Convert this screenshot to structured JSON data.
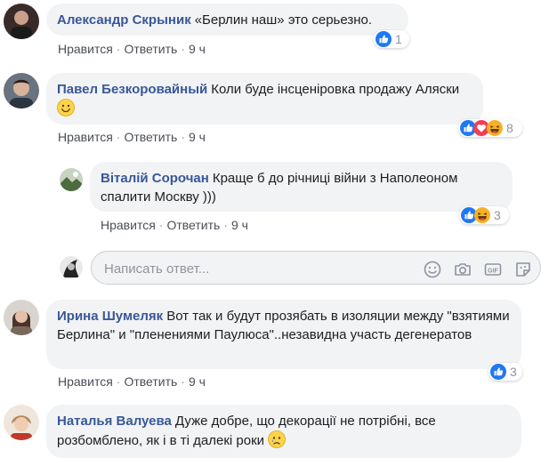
{
  "actions": {
    "like": "Нравится",
    "reply": "Ответить",
    "separator": "·"
  },
  "comments": [
    {
      "author": "Александр Скрыник",
      "text": "«Берлин наш» это серьезно.",
      "time": "9 ч",
      "reaction_count": "1",
      "reactions": [
        "like-icon"
      ]
    },
    {
      "author": "Павел Безкоровайный",
      "text": "Коли буде інсценіровка продажу Аляски",
      "emoji": "smile-emoji",
      "time": "9 ч",
      "reaction_count": "8",
      "reactions": [
        "like-icon",
        "love-icon",
        "haha-icon"
      ]
    },
    {
      "author": "Ирина Шумеляк",
      "text": "Вот так и будут прозябать в изоляции между \"взятиями Берлина\" и \"пленениями Паулюса\"..незавидна участь дегенератов",
      "time": "9 ч",
      "reaction_count": "3",
      "reactions": [
        "like-icon"
      ]
    },
    {
      "author": "Наталья Валуева",
      "text": "Дуже добре, що декорації не потрібні, все розбомблено, як і в ті далекі роки",
      "emoji": "crying-emoji"
    }
  ],
  "reply": {
    "author": "Віталій Сорочан",
    "text": "Краще б до річниці війни з Наполеоном спалити Москву )))",
    "time": "9 ч",
    "reaction_count": "3",
    "reactions": [
      "like-icon",
      "haha-icon"
    ]
  },
  "reply_input": {
    "placeholder": "Написать ответ...",
    "tools": [
      "emoji-icon",
      "camera-icon",
      "gif-icon",
      "sticker-icon"
    ]
  },
  "colors": {
    "bubble": "#f2f3f5",
    "author": "#385898",
    "like": "#2078f4",
    "love": "#f33e58",
    "haha": "#f7b125",
    "meta": "#606770"
  }
}
